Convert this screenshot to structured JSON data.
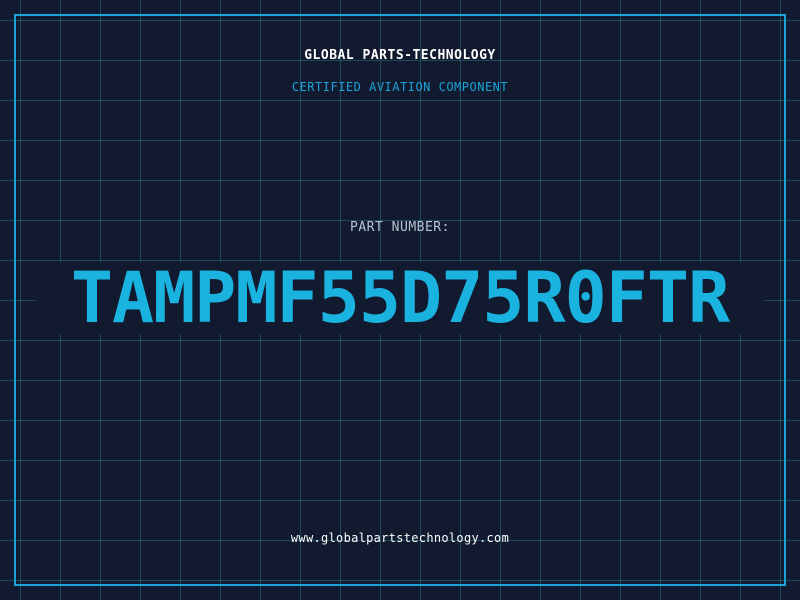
{
  "header": {
    "company": "GLOBAL PARTS-TECHNOLOGY",
    "subtitle": "CERTIFIED AVIATION COMPONENT"
  },
  "part": {
    "label": "PART NUMBER:",
    "number": "TAMPMF55D75R0FTR"
  },
  "footer": {
    "website": "www.globalpartstechnology.com"
  },
  "colors": {
    "background": "#111a2e",
    "grid": "#286e82",
    "accent": "#1aa3d6",
    "part_number": "#1ab3e0",
    "text": "#ffffff"
  }
}
